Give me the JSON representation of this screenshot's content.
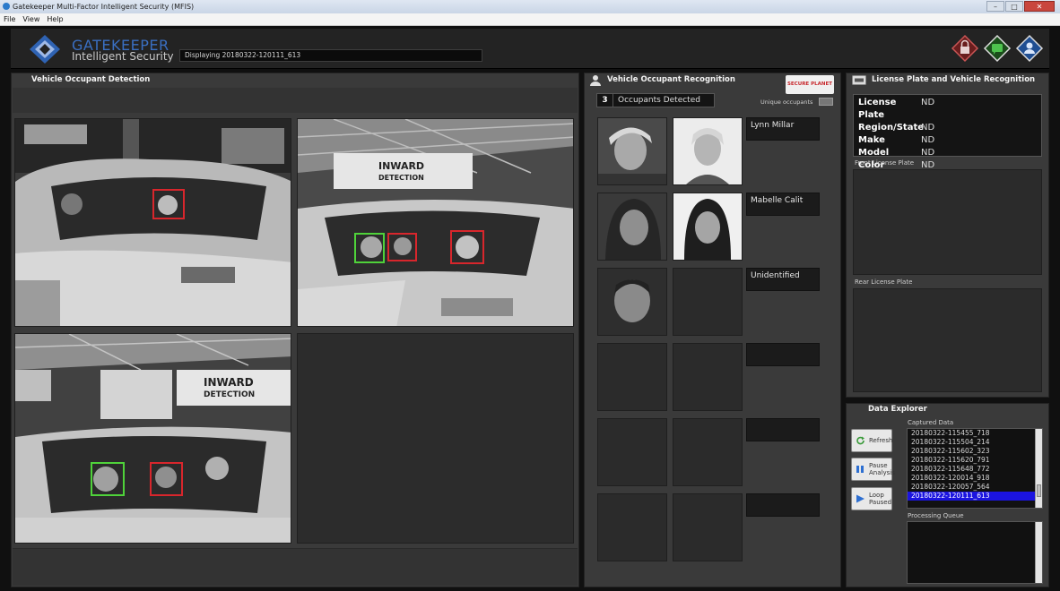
{
  "window": {
    "title": "Gatekeeper Multi-Factor Intelligent Security (MFIS)",
    "controls": [
      "minimize",
      "maximize",
      "close"
    ]
  },
  "menu": {
    "items": [
      "File",
      "View",
      "Help"
    ]
  },
  "header": {
    "brand_name": "GATEKEEPER",
    "brand_tagline": "Intelligent Security",
    "displaying_text": "Displaying 20180322-120111_613",
    "icons": [
      "lock-icon",
      "chat-icon",
      "user-icon"
    ]
  },
  "detection": {
    "title": "Vehicle Occupant Detection",
    "cameras": [
      {
        "name": "camera-1",
        "detections": [
          {
            "color": "red"
          }
        ]
      },
      {
        "name": "camera-2",
        "signage": "INWARD DETECTION",
        "detections": [
          {
            "color": "green"
          },
          {
            "color": "red"
          },
          {
            "color": "red"
          }
        ]
      },
      {
        "name": "camera-3",
        "signage": "INWARD DETECTION",
        "detections": [
          {
            "color": "green"
          },
          {
            "color": "red"
          }
        ]
      },
      {
        "name": "camera-4",
        "detections": []
      }
    ]
  },
  "occupants": {
    "title": "Vehicle Occupant Recognition",
    "count": "3",
    "count_label": "Occupants Detected",
    "unique_label": "Unique occupants",
    "sponsor_logo": "SECURE PLANET",
    "rows": [
      {
        "name": "Lynn Millar"
      },
      {
        "name": "Mabelle Calit"
      },
      {
        "name": "Unidentified"
      },
      {
        "name": ""
      },
      {
        "name": ""
      },
      {
        "name": ""
      }
    ]
  },
  "plate": {
    "title": "License Plate and Vehicle Recognition",
    "fields": [
      {
        "label": "License Plate",
        "value": "ND"
      },
      {
        "label": "Region/State",
        "value": "ND"
      },
      {
        "label": "Make",
        "value": "ND"
      },
      {
        "label": "Model",
        "value": "ND"
      },
      {
        "label": "Color",
        "value": "ND"
      }
    ],
    "front_label": "Front License Plate",
    "rear_label": "Rear License Plate"
  },
  "explorer": {
    "title": "Data Explorer",
    "captured_label": "Captured Data",
    "buttons": {
      "refresh": "Refresh",
      "pause": "Pause Analysis",
      "loop": "Loop Paused"
    },
    "captured": [
      "20180322-115455_718",
      "20180322-115504_214",
      "20180322-115602_323",
      "20180322-115620_791",
      "20180322-115648_772",
      "20180322-120014_918",
      "20180322-120057_564",
      "20180322-120111_613"
    ],
    "selected_index": 7,
    "queue_label": "Processing Queue"
  },
  "colors": {
    "accent_blue": "#3a6fc2",
    "detect_red": "#d8262c",
    "detect_green": "#4fd23a",
    "list_selection": "#1b14e0"
  }
}
